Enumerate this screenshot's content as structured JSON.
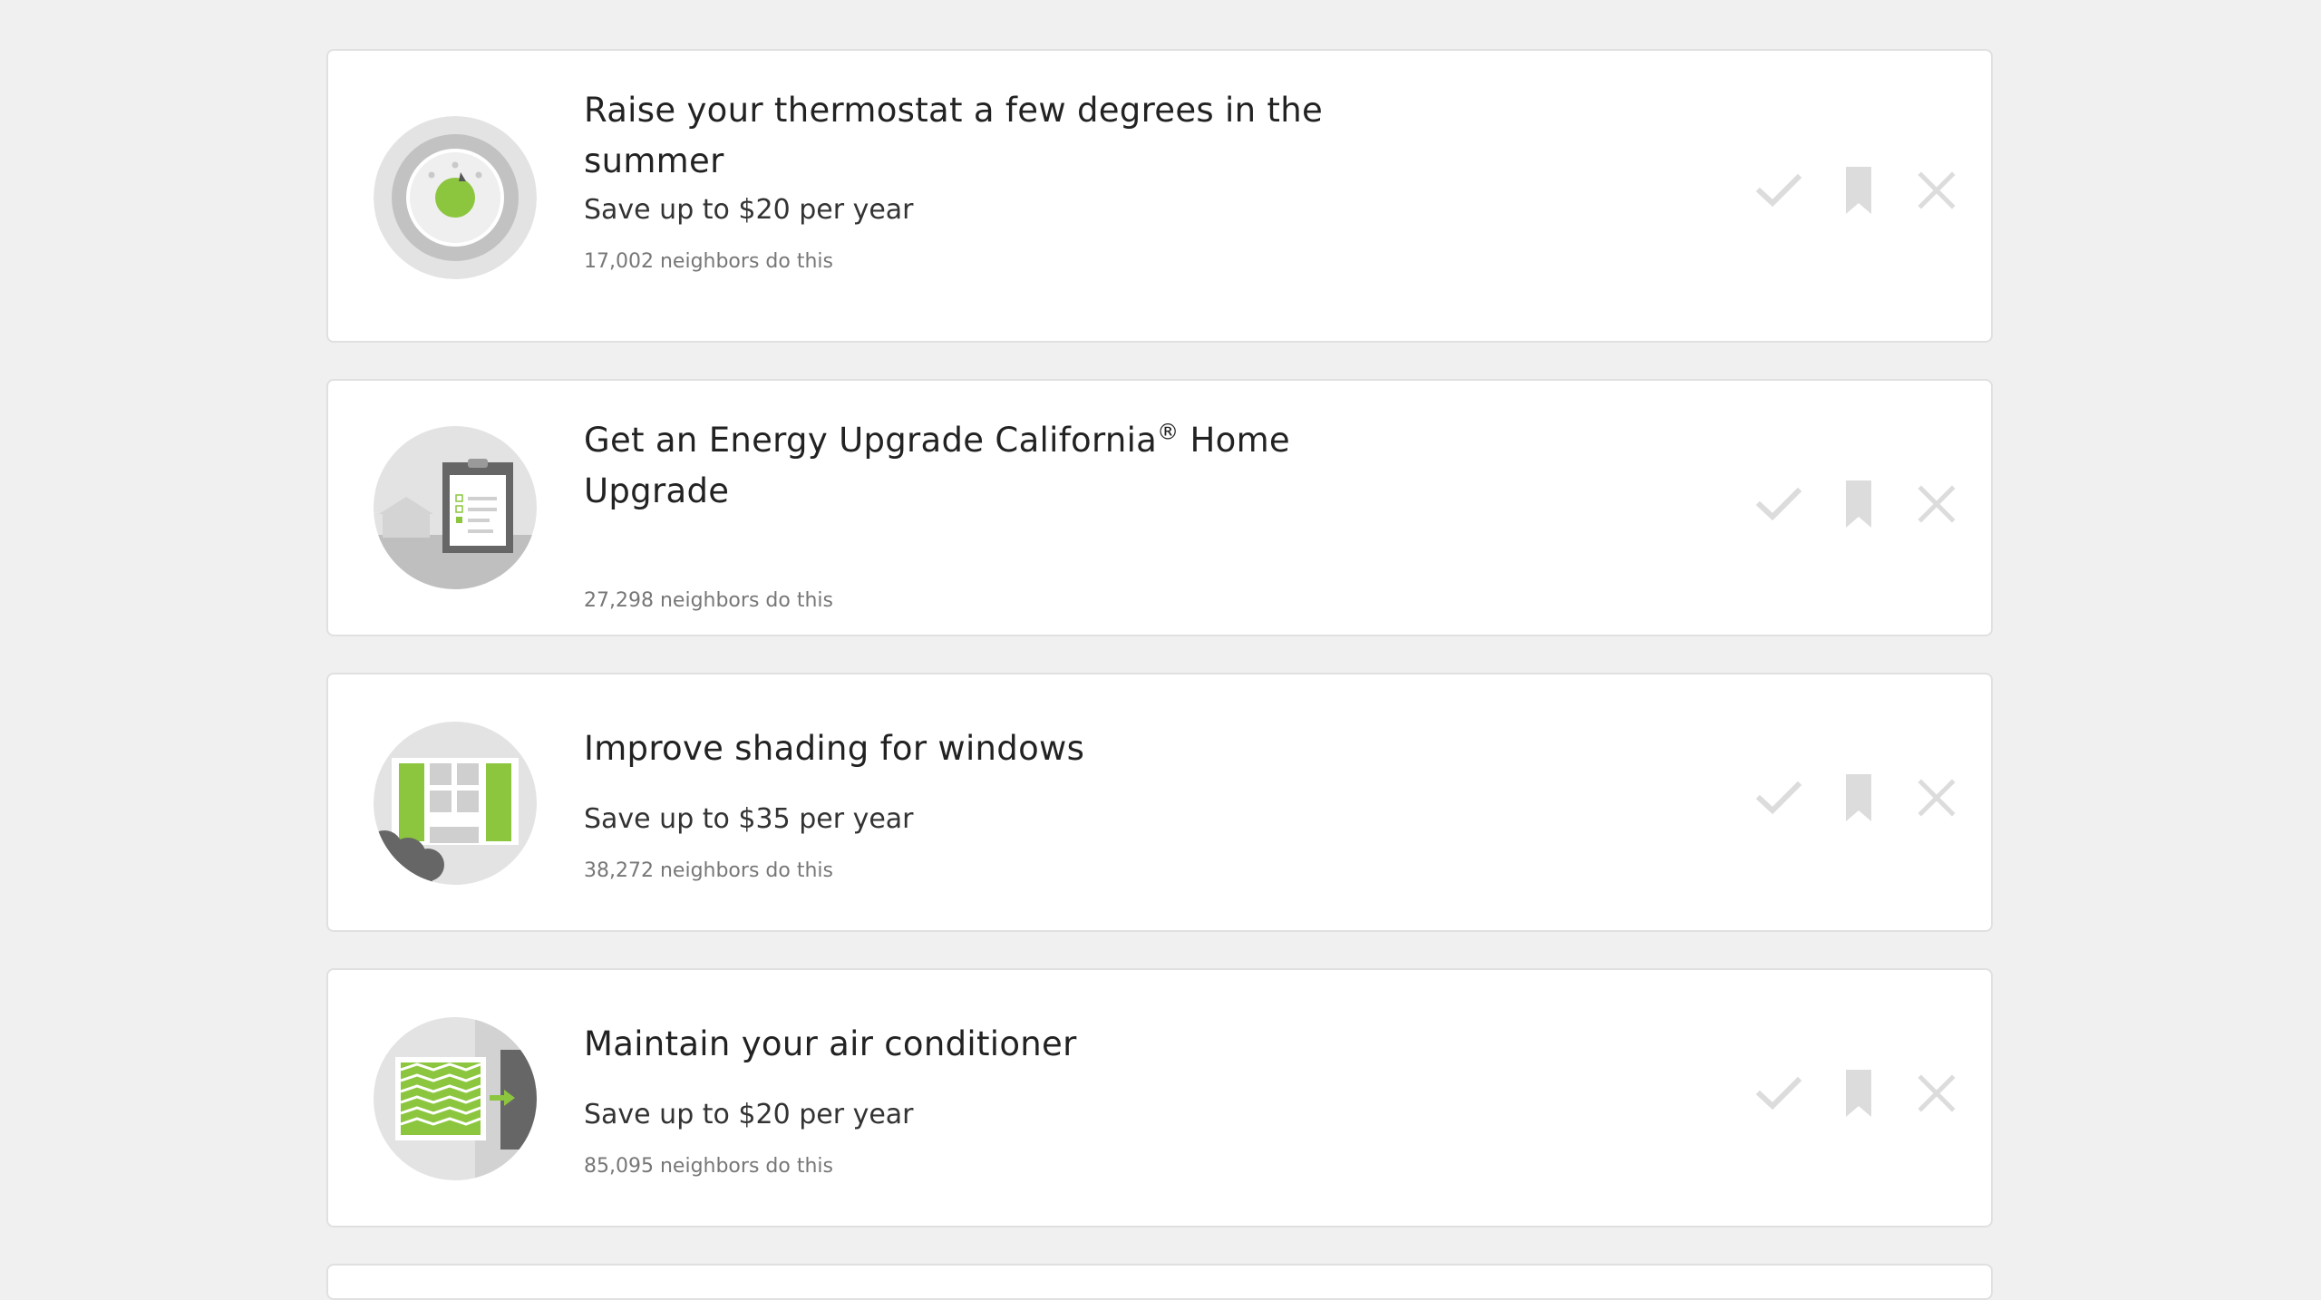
{
  "colors": {
    "page_background": "#f0f0f0",
    "card_background": "#ffffff",
    "accent_green": "#8cc63f",
    "action_icon_gray": "#dcdcdc"
  },
  "actions": {
    "done_icon": "check-icon",
    "save_icon": "bookmark-icon",
    "dismiss_icon": "close-icon"
  },
  "tips": [
    {
      "illustration": "thermostat-icon",
      "title": "Raise your thermostat a few degrees in the summer",
      "savings": "Save up to $20 per year",
      "neighbors": "17,002 neighbors do this"
    },
    {
      "illustration": "clipboard-home-icon",
      "title_main": "Get an Energy Upgrade California",
      "title_mark": "®",
      "title_tail": " Home Upgrade",
      "savings": "",
      "neighbors": "27,298 neighbors do this"
    },
    {
      "illustration": "window-shading-icon",
      "title": "Improve shading for windows",
      "savings": "Save up to $35 per year",
      "neighbors": "38,272 neighbors do this"
    },
    {
      "illustration": "air-filter-icon",
      "title": "Maintain your air conditioner",
      "savings": "Save up to $20 per year",
      "neighbors": "85,095 neighbors do this"
    }
  ]
}
